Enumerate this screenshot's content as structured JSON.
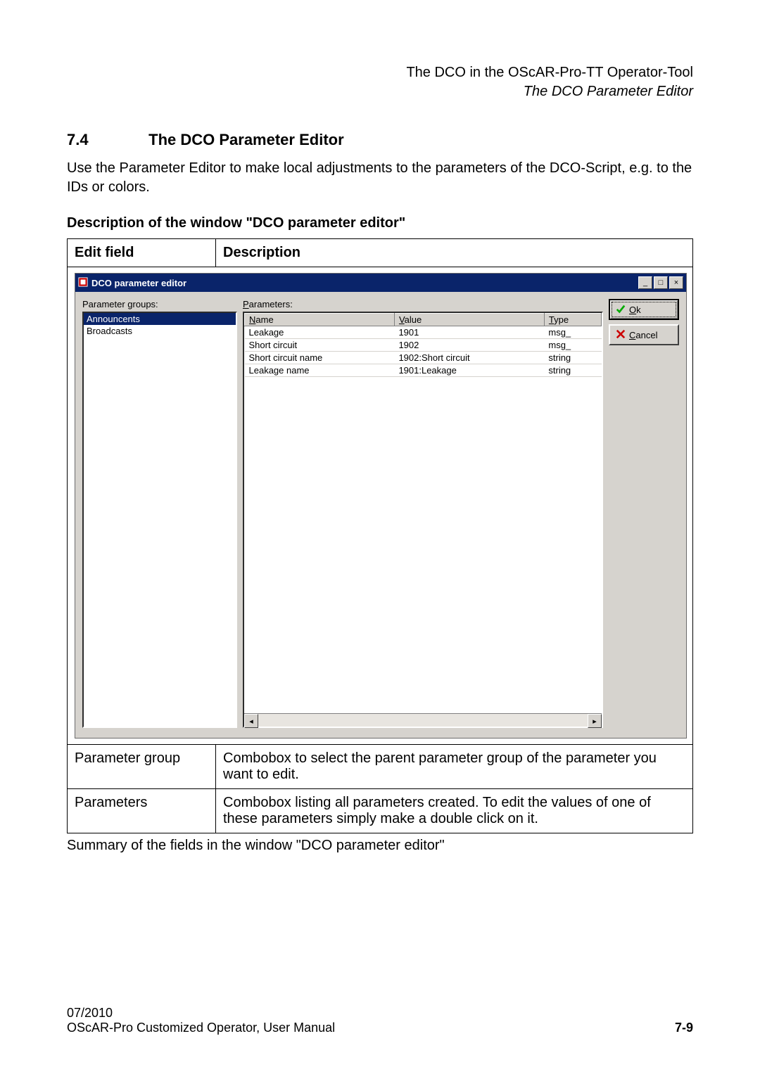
{
  "header": {
    "line1": "The DCO in the OScAR-Pro-TT Operator-Tool",
    "line2": "The DCO Parameter Editor"
  },
  "section": {
    "number": "7.4",
    "title": "The DCO Parameter Editor",
    "intro": "Use the Parameter Editor to make local adjustments to the parameters of the DCO-Script, e.g. to the IDs or colors.",
    "subhead": "Description of the window \"DCO parameter editor\""
  },
  "desc_table": {
    "h1": "Edit field",
    "h2": "Description",
    "rows": [
      {
        "field": "Parameter group",
        "desc": "Combobox to select the parent parameter group of the parameter you want to edit."
      },
      {
        "field": "Parameters",
        "desc": "Combobox listing all parameters created. To edit the values of one of these parameters simply make a double click on it."
      }
    ],
    "caption": "Summary of the fields in the window \"DCO parameter editor\""
  },
  "window": {
    "title": "DCO parameter editor",
    "labels": {
      "param_groups": "Parameter groups:",
      "param_groups_u": "P",
      "parameters": "Parameters:",
      "parameters_u": "P"
    },
    "groups": [
      {
        "name": "Announcents",
        "selected": true
      },
      {
        "name": "Broadcasts",
        "selected": false
      }
    ],
    "grid": {
      "headers": {
        "name": "Name",
        "name_u": "N",
        "value": "Value",
        "value_u": "V",
        "type": "Type",
        "type_u": "T"
      },
      "rows": [
        {
          "name": "Leakage",
          "value": "1901",
          "type": "msg_"
        },
        {
          "name": "Short circuit",
          "value": "1902",
          "type": "msg_"
        },
        {
          "name": "Short circuit name",
          "value": "1902:Short circuit",
          "type": "string"
        },
        {
          "name": "Leakage name",
          "value": "1901:Leakage",
          "type": "string"
        }
      ]
    },
    "buttons": {
      "ok": "Ok",
      "ok_u": "O",
      "cancel": "Cancel",
      "cancel_u": "C"
    }
  },
  "footer": {
    "date": "07/2010",
    "doc": "OScAR-Pro Customized Operator, User Manual",
    "page": "7-9"
  }
}
